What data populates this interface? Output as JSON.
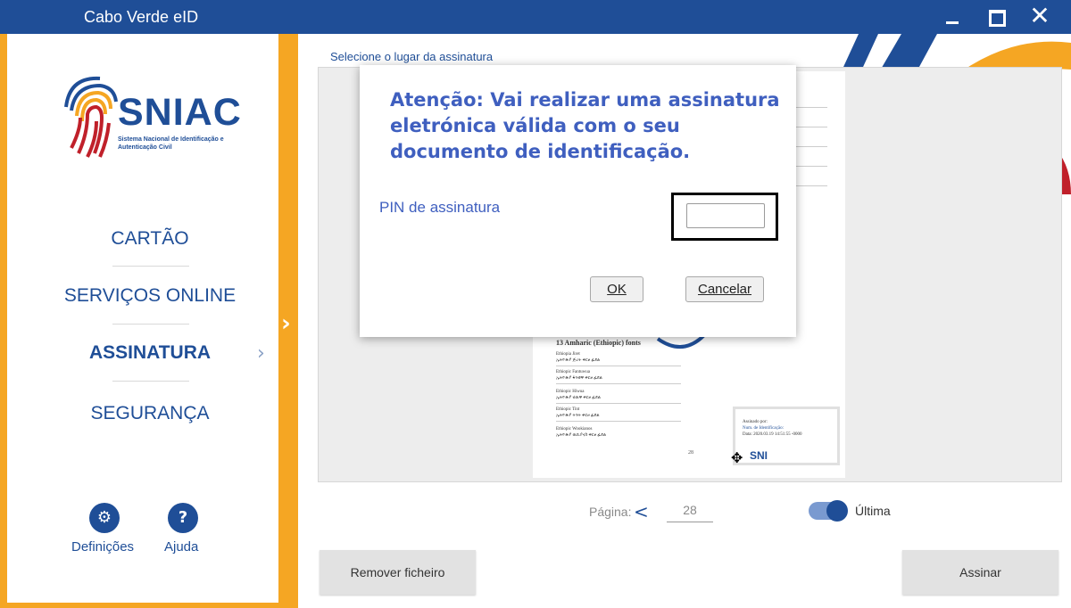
{
  "window": {
    "title": "Cabo Verde eID"
  },
  "sidebar": {
    "logo_brand": "SNIAC",
    "logo_subtitle": "Sistema Nacional de Identificação e Autenticação Civil",
    "nav": [
      {
        "label": "CARTÃO",
        "active": false
      },
      {
        "label": "SERVIÇOS ONLINE",
        "active": false
      },
      {
        "label": "ASSINATURA",
        "active": true
      },
      {
        "label": "SEGURANÇA",
        "active": false
      }
    ],
    "settings_label": "Definições",
    "help_label": "Ajuda"
  },
  "main": {
    "select_label": "Selecione o lugar da assinatura",
    "document": {
      "section_heading": "13   Amharic (Ethiopic) fonts",
      "entries": [
        {
          "name": "Ethiopia Jiret",
          "sample": "ኢትዮጵያ ጅረት ቀርፀ ፊደል"
        },
        {
          "name": "Ethiopic Fantuwua",
          "sample": "ኢትዮጵያ ፋንቱዋ ቀርፀ ፊደል"
        },
        {
          "name": "Ethiopic Hiwua",
          "sample": "ኢትዮጵያ ሂዉዋ ቀርፀ ፊደል"
        },
        {
          "name": "Ethiopic Tint",
          "sample": "ኢትዮጵያ ትንት ቀርፀ ፊደል"
        },
        {
          "name": "Ethiopic Wookianos",
          "sample": "ኢትዮጵያ ዉኪያኖስ ቀርፀ ፊደል"
        }
      ],
      "page_number": "28",
      "signature": {
        "signed_by": "Assinado por:",
        "id_line": "Num. de Identificação:",
        "date_line": "Data: 2020.03.19 14:51:55 -0000",
        "logo_text": "SNI"
      }
    },
    "pager": {
      "label": "Página:",
      "prev_symbol": "<",
      "current_page": "28"
    },
    "last_toggle": {
      "label": "Última",
      "on": true
    },
    "remove_button": "Remover ficheiro",
    "sign_button": "Assinar"
  },
  "dialog": {
    "message": "Atenção: Vai realizar uma assinatura eletrónica válida com o seu documento de identificação.",
    "pin_label": "PIN de assinatura",
    "pin_value": "",
    "ok_label": "OK",
    "cancel_label": "Cancelar"
  },
  "colors": {
    "brand_blue": "#1f4e97",
    "accent_orange": "#f5a623",
    "accent_red": "#c0202a",
    "dialog_text": "#3f5fbf"
  }
}
